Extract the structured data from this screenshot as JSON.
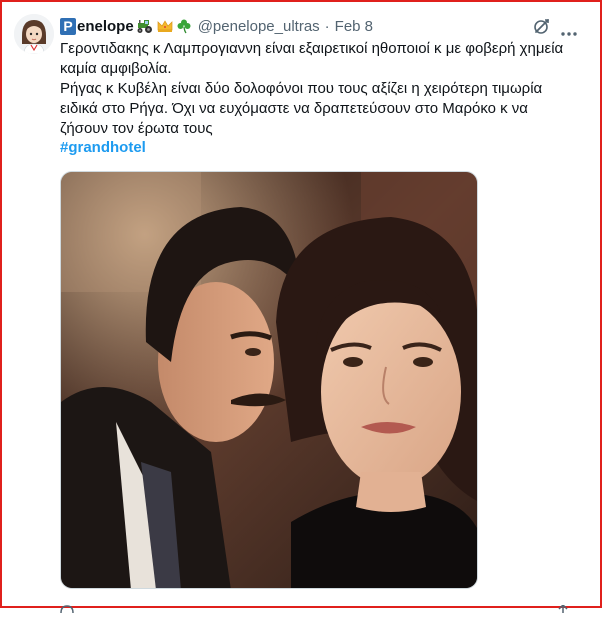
{
  "tweet": {
    "author": {
      "name_initial": "P",
      "name_rest": "enelope",
      "emojis": [
        "tractor-emoji",
        "crown-emoji",
        "shamrock-emoji"
      ],
      "handle": "@penelope_ultras",
      "separator": "·",
      "date": "Feb 8"
    },
    "text_lines": [
      "Γεροντιδακης κ Λαμπρογιαννη είναι εξαιρετικοί ηθοποιοί κ με φοβερή χημεία",
      "καμία αμφιβολία.",
      "Ρήγας κ Κυβέλη είναι δύο δολοφόνοι που τους αξίζει η χειρότερη τιμωρία",
      "ειδικά στο Ρήγα. Όχι να ευχόμαστε να  δραπετεύσουν στο Μαρόκο κ να",
      "ζήσουν τον έρωτα τους"
    ],
    "hashtag": "#grandhotel",
    "icons": [
      "grok-icon",
      "more-icon"
    ],
    "colors": {
      "accent": "#1d9bf0",
      "secondary_text": "#536471",
      "border_highlight": "#e0201c"
    }
  }
}
